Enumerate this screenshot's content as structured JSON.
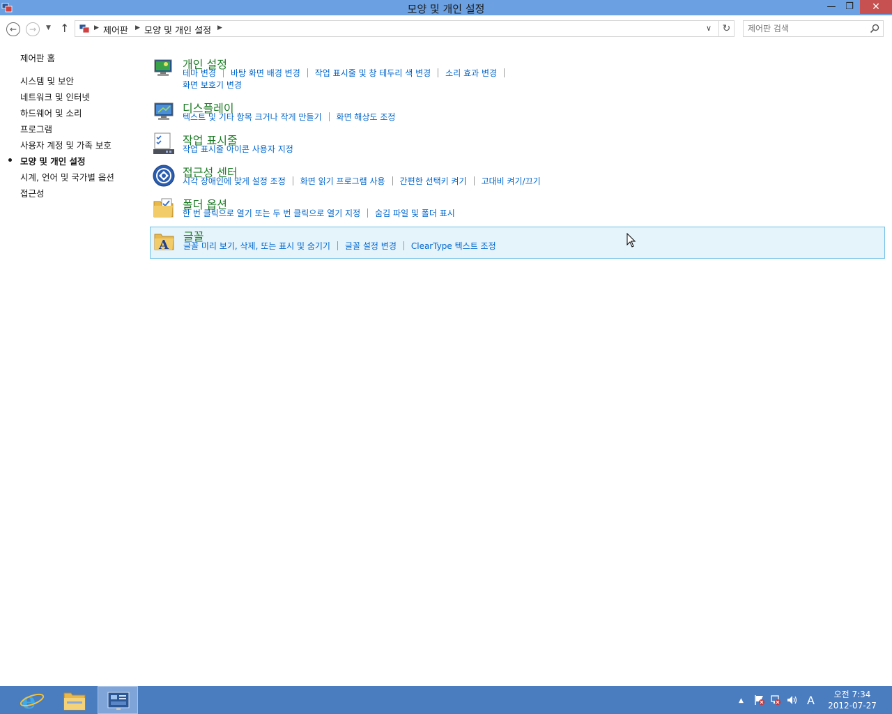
{
  "window": {
    "title": "모양 및 개인 설정",
    "minimize_glyph": "—",
    "maximize_glyph": "❐",
    "close_glyph": "✕"
  },
  "nav": {
    "back_glyph": "←",
    "forward_glyph": "→",
    "recent_glyph": "▼",
    "up_glyph": "↑",
    "breadcrumbs": [
      "제어판",
      "모양 및 개인 설정"
    ],
    "separator_glyph": "▶",
    "dropdown_glyph": "∨",
    "refresh_glyph": "↻",
    "search_placeholder": "제어판 검색"
  },
  "sidebar": {
    "items": [
      {
        "label": "제어판 홈"
      },
      {
        "label": "시스템 및 보안"
      },
      {
        "label": "네트워크 및 인터넷"
      },
      {
        "label": "하드웨어 및 소리"
      },
      {
        "label": "프로그램"
      },
      {
        "label": "사용자 계정 및 가족 보호"
      },
      {
        "label": "모양 및 개인 설정",
        "current": true
      },
      {
        "label": "시계, 언어 및 국가별 옵션"
      },
      {
        "label": "접근성"
      }
    ]
  },
  "categories": [
    {
      "title": "개인 설정",
      "icon": "personalization-icon",
      "links": [
        "테마 변경",
        "바탕 화면 배경 변경",
        "작업 표시줄 및 창 테두리 색 변경",
        "소리 효과 변경",
        "화면 보호기 변경"
      ]
    },
    {
      "title": "디스플레이",
      "icon": "display-icon",
      "links": [
        "텍스트 및 기타 항목 크거나 작게 만들기",
        "화면 해상도 조정"
      ]
    },
    {
      "title": "작업 표시줄",
      "icon": "taskbar-icon",
      "links": [
        "작업 표시줄 아이콘 사용자 지정"
      ]
    },
    {
      "title": "접근성 센터",
      "icon": "ease-of-access-icon",
      "links": [
        "시각 장애인에 맞게 설정 조정",
        "화면 읽기 프로그램 사용",
        "간편한 선택키 켜기",
        "고대비 켜기/끄기"
      ]
    },
    {
      "title": "폴더 옵션",
      "icon": "folder-options-icon",
      "links": [
        "한 번 클릭으로 열기 또는 두 번 클릭으로 열기 지정",
        "숨김 파일 및 폴더 표시"
      ]
    },
    {
      "title": "글꼴",
      "icon": "fonts-icon",
      "highlighted": true,
      "links": [
        "글꼴 미리 보기, 삭제, 또는 표시 및 숨기기",
        "글꼴 설정 변경",
        "ClearType 텍스트 조정"
      ]
    }
  ],
  "taskbar": {
    "apps": [
      {
        "name": "internet-explorer-icon"
      },
      {
        "name": "file-explorer-icon"
      },
      {
        "name": "control-panel-icon",
        "active": true
      }
    ],
    "tray": {
      "chevron_glyph": "▲",
      "ime_label": "A"
    },
    "clock": {
      "time": "오전 7:34",
      "date": "2012-07-27"
    }
  },
  "colors": {
    "titlebar": "#6ba1e2",
    "taskbar": "#4a7cc0",
    "category_title": "#1e7b26",
    "link": "#0066cc",
    "highlight_bg": "#e5f3fb",
    "highlight_border": "#70c0e7"
  }
}
